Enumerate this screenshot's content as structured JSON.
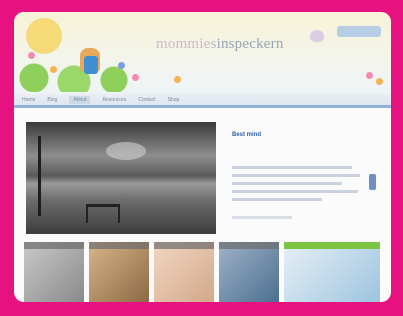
{
  "site": {
    "logo_part1": "mommies",
    "logo_part2": "inspeckern"
  },
  "nav": {
    "items": [
      "Home",
      "Blog",
      "About",
      "Resources",
      "Contact",
      "Shop"
    ],
    "active_index": 2
  },
  "featured": {
    "headline": "Best mind"
  },
  "colors": {
    "frame": "#e5127f",
    "nav_accent": "#8fb3d9",
    "headline": "#2f5ea8",
    "green_caption": "#7cc443"
  }
}
